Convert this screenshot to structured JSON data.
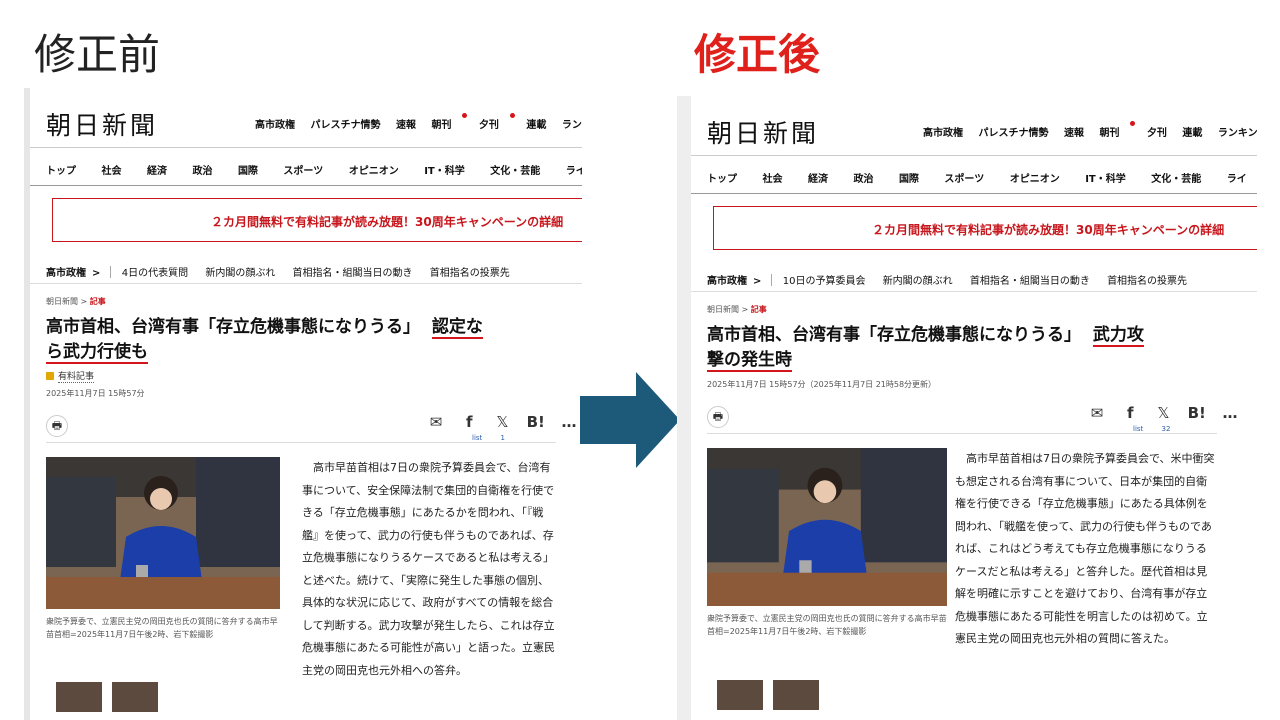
{
  "slide": {
    "before_title": "修正前",
    "after_title": "修正後",
    "arrow_color": "#1d5a7a",
    "accent": "#e0201b"
  },
  "site": {
    "logo": "朝日新聞",
    "topnav": [
      "高市政権",
      "パレスチナ情勢",
      "速報",
      "朝刊",
      "夕刊",
      "連載",
      "ランキング"
    ],
    "catnav": [
      "トップ",
      "社会",
      "経済",
      "政治",
      "国際",
      "スポーツ",
      "オピニオン",
      "IT・科学",
      "文化・芸能",
      "ライ"
    ],
    "banner": "２カ月間無料で有料記事が読み放題！30周年キャンペーンの詳細"
  },
  "before": {
    "subnav_head": "高市政権",
    "subnav_items": [
      "4日の代表質問",
      "新内閣の顔ぶれ",
      "首相指名・組閣当日の動き",
      "首相指名の投票先"
    ],
    "breadcrumb_home": "朝日新聞",
    "breadcrumb_current": "記事",
    "headline_plain": "高市首相、台湾有事「存立危機事態になりうる」",
    "headline_marked_1": "認定な",
    "headline_marked_2": "ら武力行使も",
    "paid_label": "有料記事",
    "date": "2025年11月7日 15時57分",
    "share_list": "list",
    "share_count": "1",
    "caption": "衆院予算委で、立憲民主党の岡田克也氏の質問に答弁する高市早苗首相=2025年11月7日午後2時、岩下毅撮影",
    "body": "高市早苗首相は7日の衆院予算委員会で、台湾有事について、安全保障法制で集団的自衛権を行使できる「存立危機事態」にあたるかを問われ、「『戦艦』を使って、武力の行使も伴うものであれば、存立危機事態になりうるケースであると私は考える」と述べた。続けて、「実際に発生した事態の個別、具体的な状況に応じて、政府がすべての情報を総合して判断する。武力攻撃が発生したら、これは存立危機事態にあたる可能性が高い」と語った。立憲民主党の岡田克也元外相への答弁。"
  },
  "after": {
    "subnav_head": "高市政権",
    "subnav_items": [
      "10日の予算委員会",
      "新内閣の顔ぶれ",
      "首相指名・組閣当日の動き",
      "首相指名の投票先"
    ],
    "breadcrumb_home": "朝日新聞",
    "breadcrumb_current": "記事",
    "headline_plain": "高市首相、台湾有事「存立危機事態になりうる」",
    "headline_marked_1": "武力攻",
    "headline_marked_2": "撃の発生時",
    "date": "2025年11月7日 15時57分（2025年11月7日 21時58分更新）",
    "share_list": "list",
    "share_count": "32",
    "caption": "衆院予算委で、立憲民主党の岡田克也氏の質問に答弁する高市早苗首相=2025年11月7日午後2時、岩下毅撮影",
    "body": "高市早苗首相は7日の衆院予算委員会で、米中衝突も想定される台湾有事について、日本が集団的自衛権を行使できる「存立危機事態」にあたる具体例を問われ、「戦艦を使って、武力の行使も伴うものであれば、これはどう考えても存立危機事態になりうるケースだと私は考える」と答弁した。歴代首相は見解を明確に示すことを避けており、台湾有事が存立危機事態にあたる可能性を明言したのは初めて。立憲民主党の岡田克也元外相の質問に答えた。"
  }
}
